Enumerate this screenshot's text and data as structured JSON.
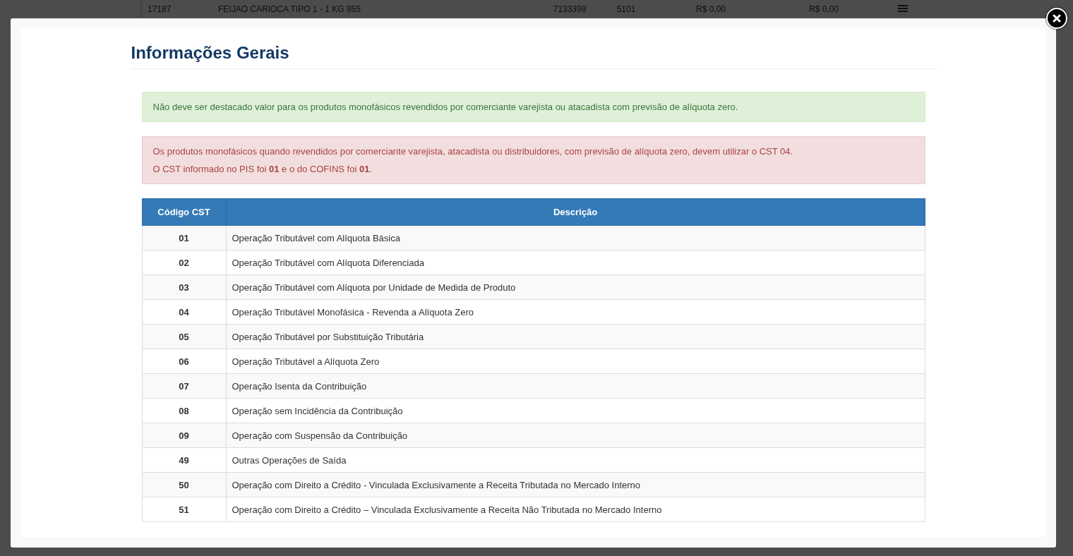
{
  "background_table": {
    "row": [
      "17187",
      "FEIJAO CARIOCA TIPO 1 - 1 KG 955",
      "7133399",
      "5101",
      "R$ 0,00",
      "R$ 0,00"
    ]
  },
  "modal": {
    "title": "Informações Gerais",
    "alerts": [
      {
        "kind": "success",
        "lines": [
          "Não deve ser destacado valor para os produtos monofásicos revendidos por comerciante varejista ou atacadista com previsão de alíquota zero."
        ]
      },
      {
        "kind": "danger",
        "lines": [
          "Os produtos monofásicos quando revendidos por comerciante varejista, atacadista ou distribuidores, com previsão de alíquota zero, devem utilizar o CST 04.",
          "O CST informado no PIS foi **01** e o do COFINS foi **01**."
        ]
      }
    ],
    "table": {
      "columns": [
        "Código CST",
        "Descrição"
      ],
      "rows": [
        [
          "01",
          "Operação Tributável com Alíquota Básica"
        ],
        [
          "02",
          "Operação Tributável com Alíquota Diferenciada"
        ],
        [
          "03",
          "Operação Tributável com Alíquota por Unidade de Medida de Produto"
        ],
        [
          "04",
          "Operação Tributável Monofásica - Revenda a Alíquota Zero"
        ],
        [
          "05",
          "Operação Tributável por Substituição Tributária"
        ],
        [
          "06",
          "Operação Tributável a Alíquota Zero"
        ],
        [
          "07",
          "Operação Isenta da Contribuição"
        ],
        [
          "08",
          "Operação sem Incidência da Contribuição"
        ],
        [
          "09",
          "Operação com Suspensão da Contribuição"
        ],
        [
          "49",
          "Outras Operações de Saída"
        ],
        [
          "50",
          "Operação com Direito a Crédito - Vinculada Exclusivamente a Receita Tributada no Mercado Interno"
        ],
        [
          "51",
          "Operação com Direito a Crédito – Vinculada Exclusivamente a Receita Não Tributada no Mercado Interno"
        ]
      ]
    }
  }
}
